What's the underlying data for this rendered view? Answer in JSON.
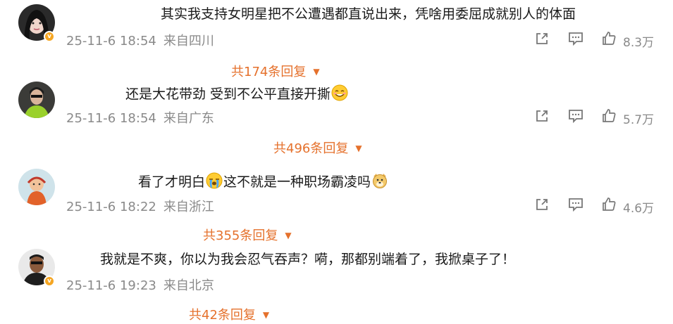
{
  "comments": [
    {
      "text": "其实我支持女明星把不公遭遇都直说出来，凭啥用委屈成就别人的体面",
      "date": "25-11-6 18:54",
      "location": "来自四川",
      "likes": "8.3万",
      "replies": "共174条回复",
      "verified": true
    },
    {
      "text_before": "还是大花带劲 受到不公平直接开撕",
      "emoji": "smile-emoji",
      "date": "25-11-6 18:54",
      "location": "来自广东",
      "likes": "5.7万",
      "replies": "共496条回复",
      "verified": false
    },
    {
      "text_a": "看了才明白",
      "emoji_a": "crying-emoji",
      "text_b": "这不就是一种职场霸凌吗",
      "emoji_b": "doge-emoji",
      "date": "25-11-6 18:22",
      "location": "来自浙江",
      "likes": "4.6万",
      "replies": "共355条回复",
      "verified": false
    },
    {
      "text": "我就是不爽，你以为我会忍气吞声？嗬，那都别端着了，我掀桌子了！",
      "date": "25-11-6 19:23",
      "location": "来自北京",
      "replies": "共42条回复",
      "verified": true
    }
  ],
  "icons": {
    "share": "share-icon",
    "comment": "comment-icon",
    "like": "like-icon",
    "expand": "triangle-down-icon"
  },
  "colors": {
    "reply_link": "#e5712c",
    "meta": "#8a8a8a",
    "badge": "#f5a623"
  }
}
